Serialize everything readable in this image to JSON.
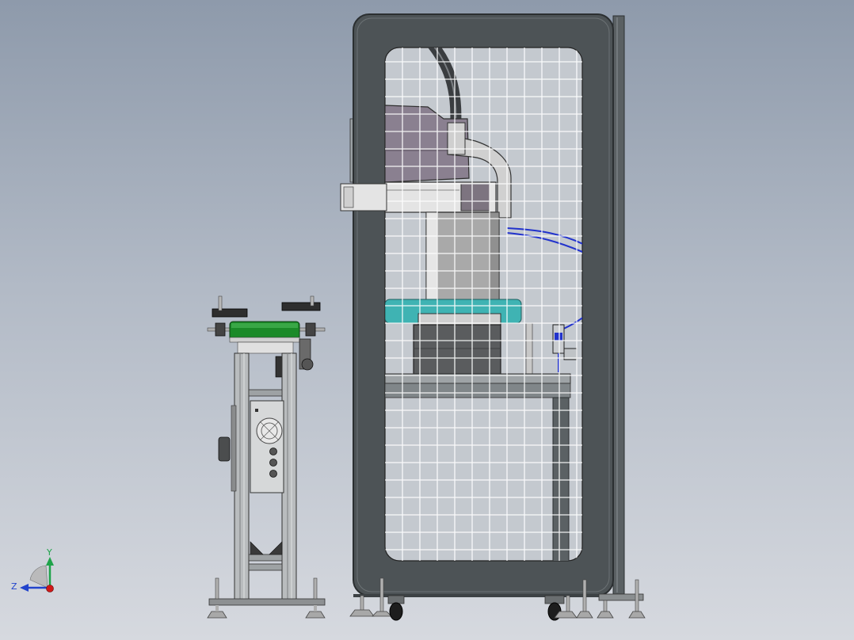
{
  "view": {
    "background_top": "#8e9aab",
    "background_bottom": "#d6d9df"
  },
  "triad": {
    "y_label": "Y",
    "z_label": "Z",
    "y_color": "#1fa34a",
    "z_color": "#2244cc",
    "origin_color": "#d01818"
  },
  "colors": {
    "frame": "#4d5356",
    "frame_edge": "#2b2f31",
    "mesh": "#ffffff",
    "robot_body": "#8a8090",
    "robot_base": "#a6a6a6",
    "teal_plate": "#3fb3b3",
    "green_roller": "#1b8a28",
    "tube_blue": "#2233cc",
    "dark_block": "#5a5c5e"
  },
  "icons": {
    "triad": "coordinate-triad-icon",
    "wheel": "caster-wheel-icon",
    "fan": "fan-grille-icon"
  }
}
